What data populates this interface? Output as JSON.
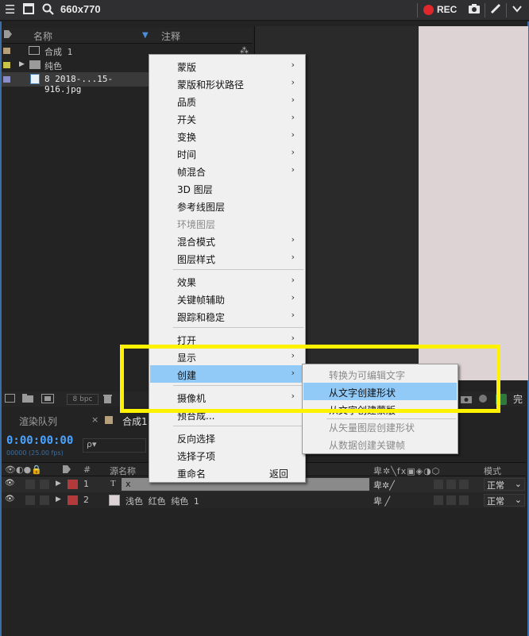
{
  "recorder": {
    "size_label": "660x770",
    "rec_label": "REC"
  },
  "project": {
    "headers": {
      "name": "名称",
      "comment": "注释"
    },
    "rows": [
      {
        "label": "合成 1",
        "swatch": "#b5a07a"
      },
      {
        "label": "纯色",
        "swatch": "#c9c34a"
      },
      {
        "label": "8 2018-...15-916.jpg",
        "swatch": "#8a8ec8"
      }
    ],
    "bpc": "8 bpc"
  },
  "right_panel": {
    "done_label": "完"
  },
  "timeline": {
    "tabs": [
      "渲染队列",
      "合成1"
    ],
    "timecode": "0:00:00:00",
    "fps": "00000 (25.00 fps)",
    "search_placeholder": "ρ▾",
    "headers": {
      "num": "#",
      "source_name": "源名称",
      "mode": "模式"
    },
    "rows": [
      {
        "num": "1",
        "label": "x",
        "type_icon": "T",
        "mode": "正常"
      },
      {
        "num": "2",
        "label": "浅色 红色 纯色 1",
        "type_icon": "",
        "mode": "正常"
      }
    ]
  },
  "context_menu": {
    "items": [
      {
        "label": "蒙版",
        "arrow": true
      },
      {
        "label": "蒙版和形状路径",
        "arrow": true
      },
      {
        "label": "品质",
        "arrow": true
      },
      {
        "label": "开关",
        "arrow": true
      },
      {
        "label": "变换",
        "arrow": true
      },
      {
        "label": "时间",
        "arrow": true
      },
      {
        "label": "帧混合",
        "arrow": true
      },
      {
        "label": "3D 图层",
        "arrow": false
      },
      {
        "label": "参考线图层",
        "arrow": false
      },
      {
        "label": "环境图层",
        "arrow": false,
        "disabled": true
      },
      {
        "label": "混合模式",
        "arrow": true
      },
      {
        "label": "图层样式",
        "arrow": true
      },
      {
        "label": "效果",
        "arrow": true
      },
      {
        "label": "关键帧辅助",
        "arrow": true
      },
      {
        "label": "跟踪和稳定",
        "arrow": true
      },
      {
        "label": "打开",
        "arrow": true
      },
      {
        "label": "显示",
        "arrow": true
      },
      {
        "label": "创建",
        "arrow": true,
        "highlighted": true
      },
      {
        "label": "摄像机",
        "arrow": true
      },
      {
        "label": "预合成...",
        "arrow": false
      },
      {
        "label": "反向选择",
        "arrow": false
      },
      {
        "label": "选择子项",
        "arrow": false
      },
      {
        "label": "重命名",
        "arrow": false,
        "shortcut": "返回"
      }
    ]
  },
  "create_submenu": {
    "items": [
      {
        "label": "转换为可编辑文字",
        "disabled": true
      },
      {
        "label": "从文字创建形状",
        "highlighted": true
      },
      {
        "label": "从文字创建蒙版",
        "disabled": false
      },
      {
        "label": "从矢量图层创建形状",
        "disabled": true
      },
      {
        "label": "从数据创建关键帧",
        "disabled": true
      }
    ]
  },
  "colors": {
    "menu_highlight": "#91c9f7",
    "annotation_box": "#fff200",
    "timecode": "#4aa3ff",
    "rec_dot": "#e0272b"
  }
}
